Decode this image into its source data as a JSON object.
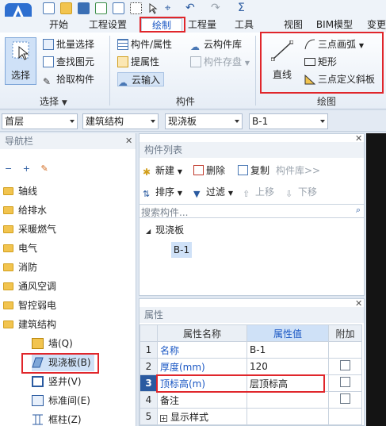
{
  "tabs": [
    "开始",
    "工程设置",
    "绘制",
    "工程量",
    "工具",
    "视图",
    "BIM模型",
    "变更"
  ],
  "ribbon": {
    "select_group": {
      "big_button": "选择",
      "items": [
        "批量选择",
        "查找图元",
        "拾取构件"
      ],
      "label": "选择"
    },
    "component_group": {
      "items": [
        "构件/属性",
        "云构件库",
        "提属性",
        "构件存盘",
        "云输入"
      ],
      "label": "构件"
    },
    "draw_group": {
      "big_button": "直线",
      "items": [
        "三点画弧",
        "矩形",
        "三点定义斜板"
      ],
      "label": "绘图"
    }
  },
  "dropdowns": [
    "首层",
    "建筑结构",
    "现浇板",
    "B-1"
  ],
  "nav": {
    "title": "导航栏",
    "items": [
      "轴线",
      "给排水",
      "采暖燃气",
      "电气",
      "消防",
      "通风空调",
      "智控弱电",
      "建筑结构"
    ],
    "sub_items": [
      "墙(Q)",
      "现浇板(B)",
      "竖井(V)",
      "标准间(E)",
      "框柱(Z)"
    ]
  },
  "complist": {
    "title": "构件列表",
    "toolbar1": [
      "新建",
      "删除",
      "复制",
      "构件库>>"
    ],
    "toolbar2": [
      "排序",
      "过滤",
      "上移",
      "下移"
    ],
    "search_placeholder": "搜索构件...",
    "tree_root": "现浇板",
    "tree_child": "B-1"
  },
  "props": {
    "title": "属性",
    "headers": [
      "属性名称",
      "属性值",
      "附加"
    ],
    "rows": [
      {
        "num": "1",
        "name": "名称",
        "value": "B-1"
      },
      {
        "num": "2",
        "name": "厚度(mm)",
        "value": "120"
      },
      {
        "num": "3",
        "name": "顶标高(m)",
        "value": "层顶标高"
      },
      {
        "num": "4",
        "name": "备注",
        "value": ""
      },
      {
        "num": "5",
        "name": "显示样式",
        "value": ""
      }
    ]
  },
  "colors": {
    "accent": "#1a57c4",
    "highlight": "#e0262b",
    "selected_bg": "#cfe1f7"
  }
}
